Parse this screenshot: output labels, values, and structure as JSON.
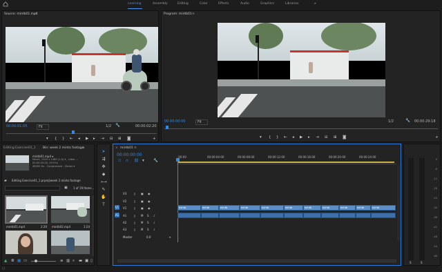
{
  "workspaces": {
    "tabs": [
      "Learning",
      "Assembly",
      "Editing",
      "Color",
      "Effects",
      "Audio",
      "Graphics",
      "Libraries"
    ],
    "active": "Learning",
    "more_label": "»"
  },
  "source": {
    "title": "Source: mintb01.mp4",
    "menu_label": "≡",
    "timecode": "00:00:01:05",
    "fit": "Fit",
    "fraction": "1/2",
    "duration": "00:00:02:20"
  },
  "program": {
    "title": "Program: mintb01",
    "menu_label": "≡",
    "timecode": "00:00:00:00",
    "fit": "Fit",
    "fraction": "1/2",
    "duration": "00:00:29:18"
  },
  "project": {
    "tab1": "Editing Exercise01_1",
    "tab2": "Bin: week 2 minto footage",
    "menu_label": "≡",
    "clip_name": "mintb01.mp4 ▾",
    "clip_info": [
      "Movie, 1920 x 1080 (1.0) ▾ , video ...",
      "00:00:02:20, 29.97p",
      "48000 Hz - Compressed - Stereo ▾"
    ],
    "path": "Editing Exercise01_1.prproj\\week 2 minto footage",
    "count": "1 of 19 Items...",
    "items": [
      {
        "name": "mintb01.mp4",
        "dur": "2:20"
      },
      {
        "name": "mintb02.mp4",
        "dur": "1:24"
      },
      {
        "name": "",
        "dur": ""
      },
      {
        "name": "",
        "dur": ""
      }
    ]
  },
  "timeline": {
    "tab": "mintb01",
    "menu_label": "≡",
    "timecode": "00:00:00:00",
    "ruler": [
      ":00:00",
      "00:00:04:00",
      "00:00:08:00",
      "00:00:12:00",
      "00:00:16:00",
      "00:00:20:00",
      "00:00:24:00"
    ],
    "tracks": [
      {
        "id": "V3",
        "kind": "video"
      },
      {
        "id": "V2",
        "kind": "video"
      },
      {
        "id": "V1",
        "kind": "video"
      },
      {
        "id": "A1",
        "kind": "audio"
      },
      {
        "id": "A2",
        "kind": "audio"
      },
      {
        "id": "A3",
        "kind": "audio"
      }
    ],
    "master_label": "Master",
    "master_value": "0.0",
    "v1_label": "V1",
    "a1_label": "A1",
    "clip_label": "mintb"
  },
  "meters": {
    "ticks": [
      "0",
      "-6",
      "-12",
      "-18",
      "-24",
      "-30",
      "-36",
      "-42",
      "-48",
      "-54",
      "dB"
    ],
    "bottom": [
      "S",
      "S"
    ]
  },
  "colors": {
    "accent": "#2d8ceb",
    "video_clip": "#5b8fc7",
    "audio_clip": "#3d70a8",
    "playhead": "#2d8ceb"
  }
}
